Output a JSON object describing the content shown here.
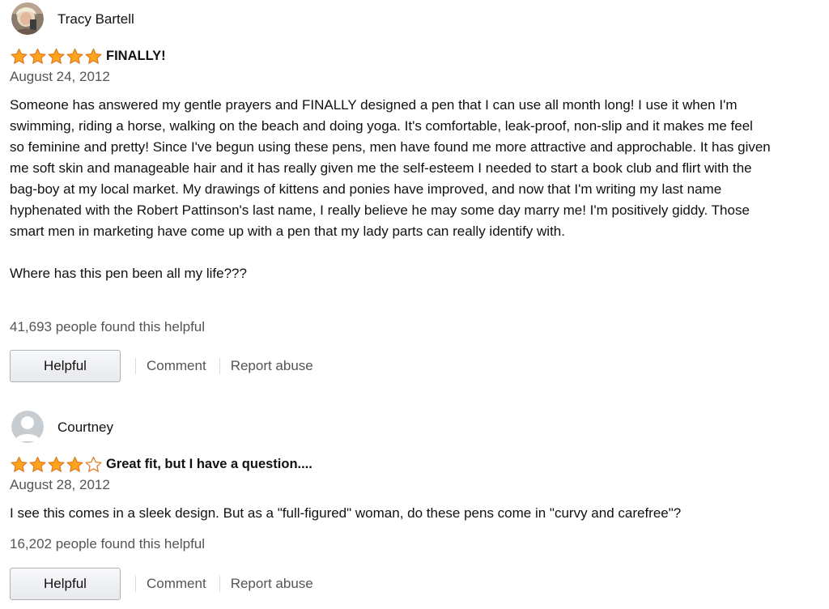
{
  "reviews": [
    {
      "author": "Tracy Bartell",
      "avatar": "photo-avatar",
      "rating": 5,
      "max_rating": 5,
      "title": "FINALLY!",
      "date": "August 24, 2012",
      "paragraphs": [
        "Someone has answered my gentle prayers and FINALLY designed a pen that I can use all month long! I use it when I'm swimming, riding a horse, walking on the beach and doing yoga. It's comfortable, leak-proof, non-slip and it makes me feel so feminine and pretty! Since I've begun using these pens, men have found me more attractive and approchable. It has given me soft skin and manageable hair and it has really given me the self-esteem I needed to start a book club and flirt with the bag-boy at my local market. My drawings of kittens and ponies have improved, and now that I'm writing my last name hyphenated with the Robert Pattinson's last name, I really believe he may some day marry me! I'm positively giddy. Those smart men in marketing have come up with a pen that my lady parts can really identify with.",
        "Where has this pen been all my life???"
      ],
      "helpful_text": "41,693 people found this helpful",
      "helpful_button": "Helpful",
      "comment_link": "Comment",
      "report_link": "Report abuse"
    },
    {
      "author": "Courtney",
      "avatar": "default-user-avatar",
      "rating": 4,
      "max_rating": 5,
      "title": "Great fit, but I have a question....",
      "date": "August 28, 2012",
      "paragraphs": [
        "I see this comes in a sleek design. But as a \"full-figured\" woman, do these pens come in \"curvy and carefree\"?"
      ],
      "helpful_text": "16,202 people found this helpful",
      "helpful_button": "Helpful",
      "comment_link": "Comment",
      "report_link": "Report abuse"
    }
  ],
  "colors": {
    "star_fill": "#ffa41c",
    "star_stroke": "#de7921",
    "text_primary": "#111111",
    "text_secondary": "#555555",
    "button_border": "#adb1b8",
    "divider": "#dddddd"
  },
  "icons": {
    "star_filled": "star-filled-icon",
    "star_empty": "star-empty-icon"
  }
}
